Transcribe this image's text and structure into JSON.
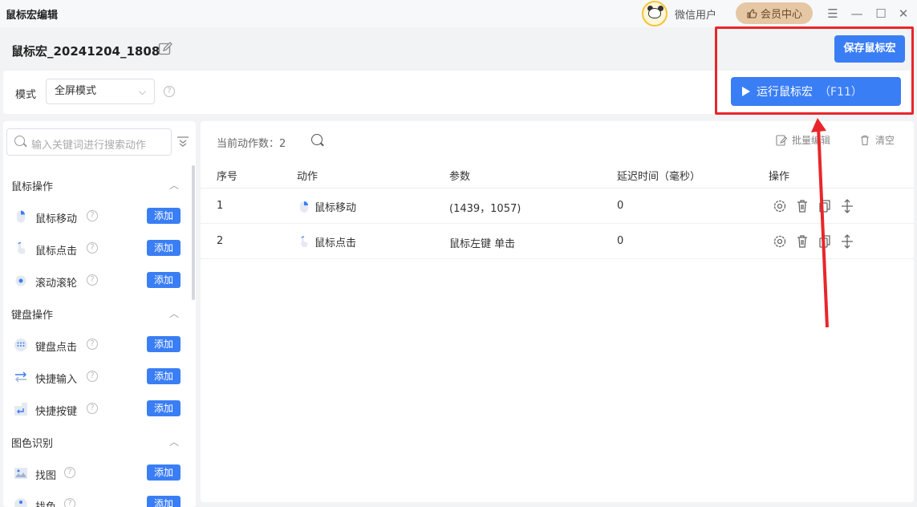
{
  "window": {
    "title": "鼠标宏编辑",
    "user_name": "微信用户",
    "vip_label": "会员中心",
    "menu_icon": "hamburger-icon",
    "controls": [
      "minimize-icon",
      "maximize-icon",
      "close-icon"
    ]
  },
  "header": {
    "macro_name": "鼠标宏_20241204_1808",
    "save_label": "保存鼠标宏"
  },
  "modebar": {
    "mode_label": "模式",
    "mode_value": "全屏模式",
    "run_label": "运行鼠标宏",
    "run_hotkey": "（F11）"
  },
  "sidebar": {
    "search_placeholder": "输入关键词进行搜索动作",
    "add_label": "添加",
    "categories": [
      {
        "label": "鼠标操作",
        "items": [
          {
            "label": "鼠标移动",
            "icon": "mouse-move-icon"
          },
          {
            "label": "鼠标点击",
            "icon": "mouse-click-icon"
          },
          {
            "label": "滚动滚轮",
            "icon": "scroll-wheel-icon"
          }
        ]
      },
      {
        "label": "键盘操作",
        "items": [
          {
            "label": "键盘点击",
            "icon": "keyboard-icon"
          },
          {
            "label": "快捷输入",
            "icon": "quick-input-icon"
          },
          {
            "label": "快捷按键",
            "icon": "enter-key-icon"
          }
        ]
      },
      {
        "label": "图色识别",
        "items": [
          {
            "label": "找图",
            "icon": "image-icon"
          },
          {
            "label": "找色",
            "icon": "color-picker-icon"
          }
        ]
      }
    ]
  },
  "table": {
    "count_label": "当前动作数：2",
    "batch_edit_label": "批量编辑",
    "clear_label": "清空",
    "headers": [
      "序号",
      "动作",
      "参数",
      "延迟时间（毫秒）",
      "操作"
    ],
    "rows": [
      {
        "index": "1",
        "action": "鼠标移动",
        "param": "(1439，1057)",
        "delay": "0"
      },
      {
        "index": "2",
        "action": "鼠标点击",
        "param": "鼠标左键 单击",
        "delay": "0"
      }
    ]
  },
  "colors": {
    "primary": "#3a7ef5",
    "vip": "#e5c7a4",
    "highlight": "#e8262a"
  }
}
